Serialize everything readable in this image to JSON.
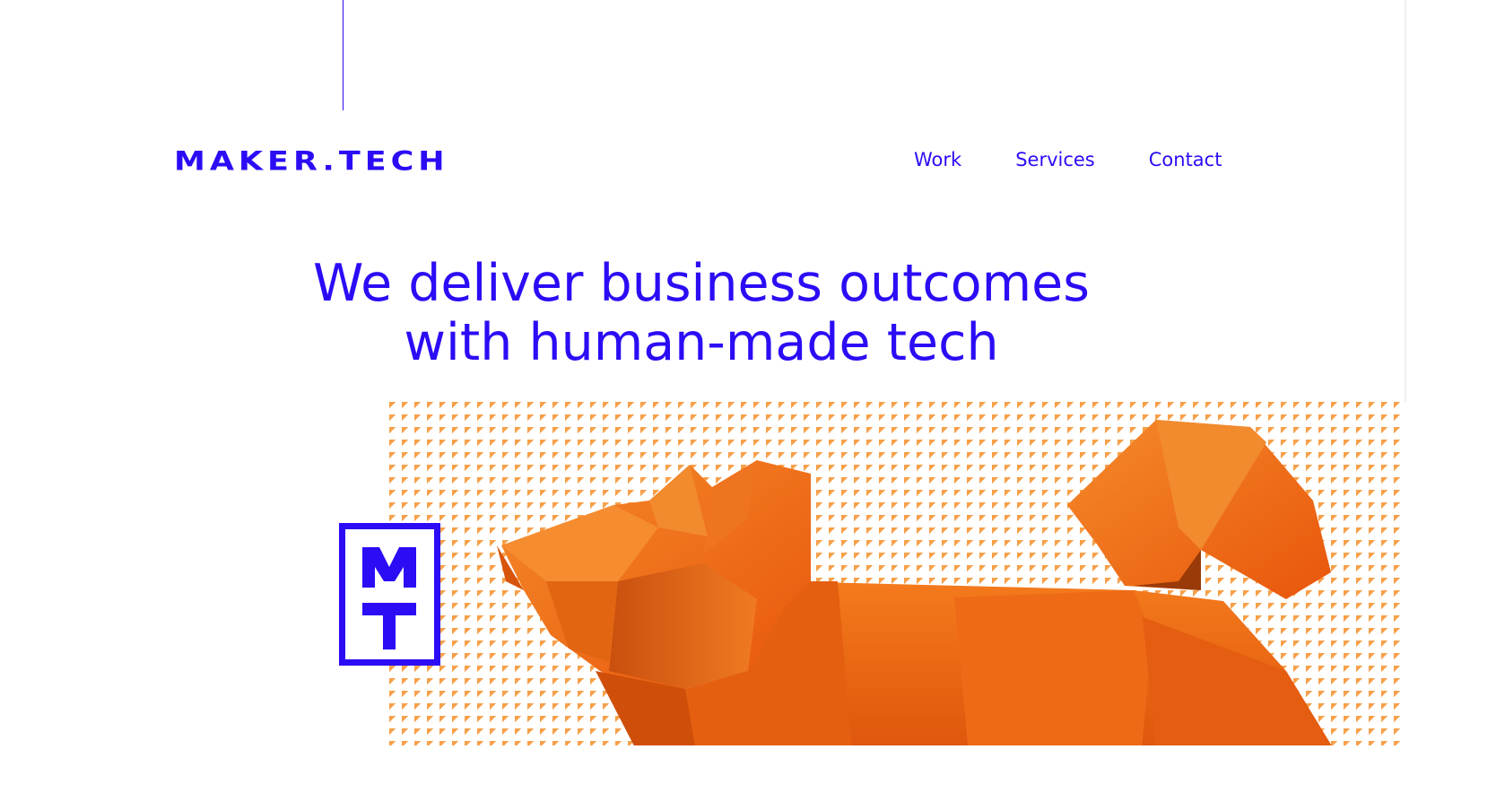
{
  "header": {
    "logo_text": "MAKER.TECH",
    "nav": [
      {
        "label": "Work"
      },
      {
        "label": "Services"
      },
      {
        "label": "Contact"
      }
    ]
  },
  "hero": {
    "line1": "We deliver business outcomes",
    "line2": "with human-made tech"
  },
  "badge": {
    "letters": "MT"
  },
  "colors": {
    "brand_blue": "#2b0cf5",
    "origami_orange": "#f06a14",
    "pattern_orange": "#f7a04a",
    "background": "#ffffff"
  },
  "image": {
    "subject": "origami-dog"
  }
}
